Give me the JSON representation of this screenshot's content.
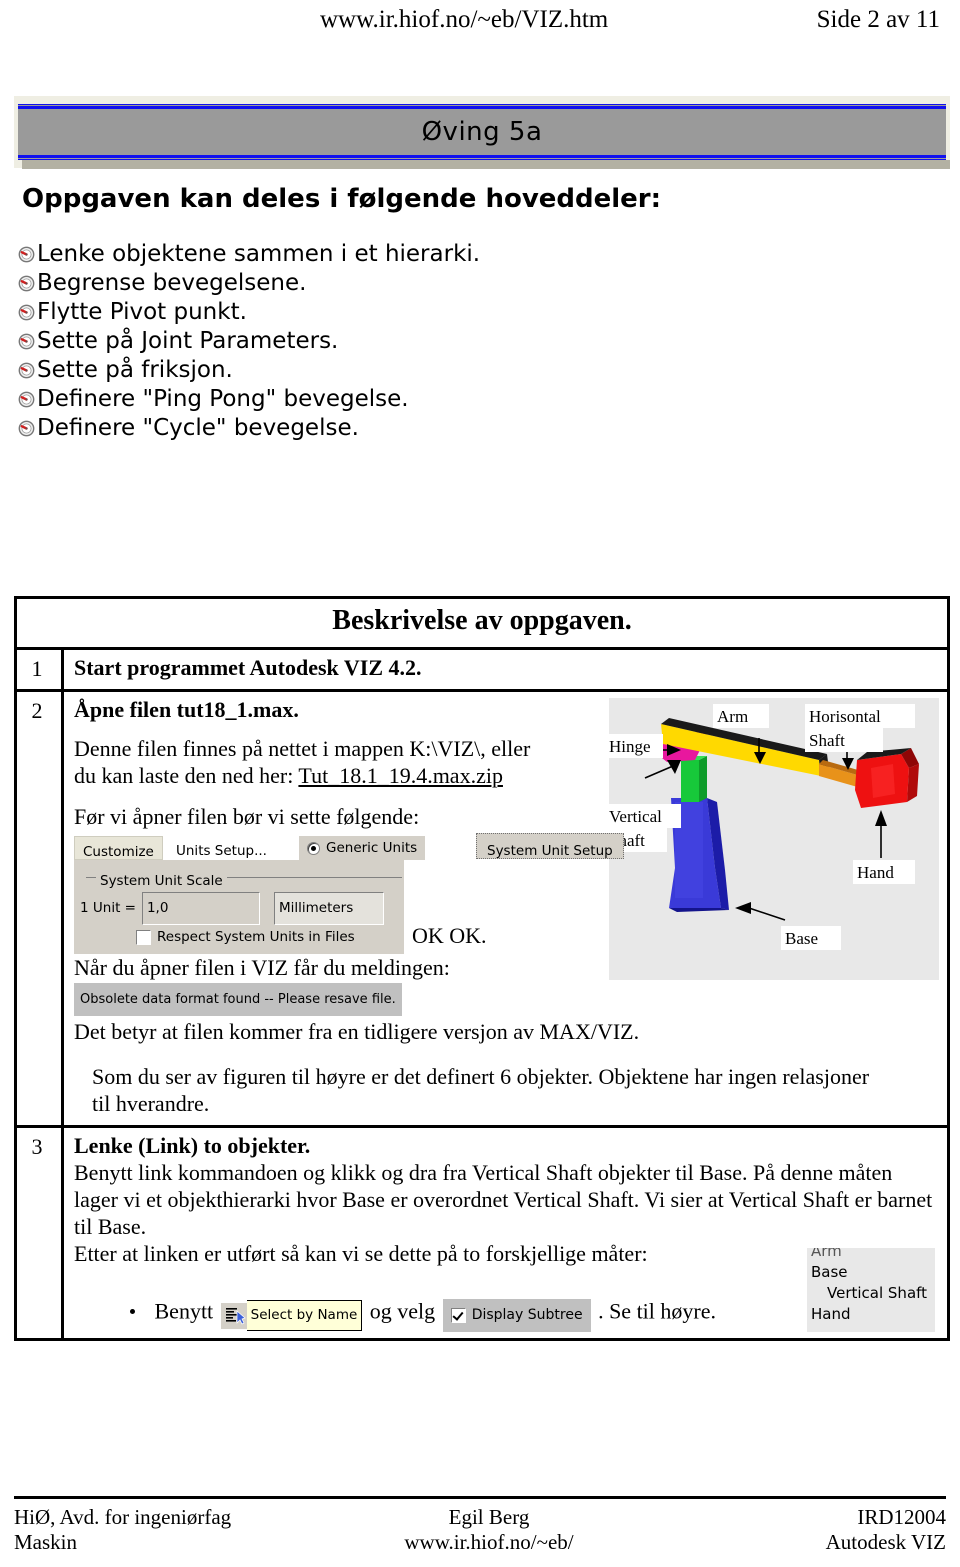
{
  "header": {
    "url": "www.ir.hiof.no/~eb/VIZ.htm",
    "page_label": "Side 2 av 11"
  },
  "banner": {
    "title": "Øving  5a",
    "border_color": "#1010ee",
    "background_color": "#9a9a9a"
  },
  "intro": {
    "heading": "Oppgaven kan deles i følgende hoveddeler:",
    "bullets": [
      "Lenke objektene sammen i et hierarki.",
      "Begrense bevegelsene.",
      "Flytte Pivot punkt.",
      "Sette på Joint Parameters.",
      "Sette på friksjon.",
      "Definere \"Ping Pong\" bevegelse.",
      "Definere \"Cycle\" bevegelse."
    ]
  },
  "table": {
    "title": "Beskrivelse av oppgaven.",
    "rows": [
      {
        "num": "1",
        "heading": "Start programmet Autodesk VIZ 4.2."
      },
      {
        "num": "2",
        "heading": "Åpne filen tut18_1.max.",
        "para1a": "Denne filen finnes på nettet i mappen K:\\VIZ\\, eller",
        "para1b": "du kan laste den ned her:",
        "link": "Tut_18.1_19.4.max.zip",
        "para2": "Før vi åpner filen bør vi sette følgende:",
        "ok_text": "OK OK.",
        "para3": "Når du åpner filen i VIZ får du meldingen:",
        "msgbar": "Obsolete data format found -- Please resave file.",
        "para4": "Det betyr at filen kommer fra en tidligere versjon av MAX/VIZ.",
        "para5a": "Som du ser av figuren til høyre er det definert 6 objekter. Objektene har ingen relasjoner",
        "para5b": "til hverandre."
      },
      {
        "num": "3",
        "heading": "Lenke (Link) to objekter.",
        "para1": "Benytt link kommandoen og klikk og dra fra Vertical Shaft objekter til Base. På denne måten lager vi et objekthierarki hvor Base er overordnet Vertical Shaft. Vi sier at Vertical Shaft er barnet til Base.",
        "para2": "Etter at linken er utført så kan vi se dette på to forskjellige måter:",
        "bullet_pre": "Benytt",
        "bullet_mid": "og velg",
        "bullet_post": ". Se til høyre."
      }
    ]
  },
  "widgets": {
    "customize": "Customize",
    "units_setup": "Units Setup...",
    "generic_units": "Generic Units",
    "system_unit_setup": "System Unit Setup",
    "system_unit_scale": "System Unit Scale",
    "one_unit_label": "1 Unit =",
    "one_unit_value": "1,0",
    "unit_type": "Millimeters",
    "respect_units": "Respect System Units in Files",
    "select_by_name": "Select by Name",
    "display_subtree": "Display Subtree"
  },
  "object_list": {
    "items": [
      "Arm",
      "Base",
      "Vertical Shaft",
      "Hand"
    ]
  },
  "figure": {
    "labels": {
      "arm": "Arm",
      "horisontal": "Horisontal",
      "shaft": "Shaft",
      "hinge": "Hinge",
      "vertical": "Vertical",
      "vshaft": "Shaft",
      "hand": "Hand",
      "base": "Base"
    },
    "colors": {
      "arm": "#ffd900",
      "hinge": "#e8179e",
      "vertical_shaft": "#17c93a",
      "base": "#2a2ae0",
      "hand": "#ee1111",
      "horisontal_shaft": "#e8921a"
    }
  },
  "footer": {
    "left_line1": "HiØ, Avd. for ingeniørfag",
    "left_line2": "Maskin",
    "center_line1": "Egil Berg",
    "center_line2": "www.ir.hiof.no/~eb/",
    "right_line1": "IRD12004",
    "right_line2": "Autodesk VIZ"
  }
}
